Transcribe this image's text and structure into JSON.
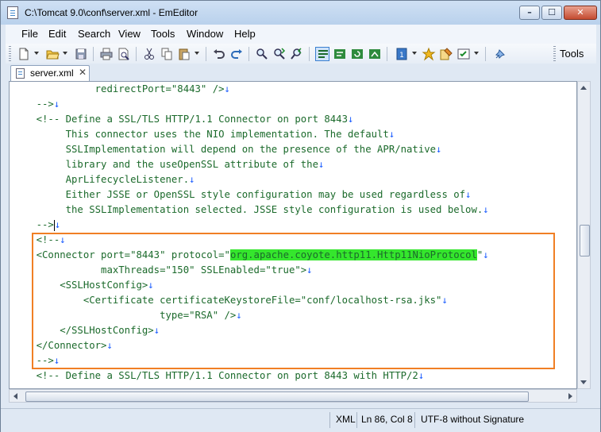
{
  "window": {
    "title": "C:\\Tomcat 9.0\\conf\\server.xml - EmEditor",
    "controls": {
      "minimize": "–",
      "maximize": "☐",
      "close": "✕"
    }
  },
  "menu": {
    "items": [
      "File",
      "Edit",
      "Search",
      "View",
      "Tools",
      "Window",
      "Help"
    ]
  },
  "toolbar": {
    "tools_label": "Tools",
    "icons": [
      "new-file-icon",
      "open-folder-icon",
      "save-icon",
      "print-icon",
      "print-preview-icon",
      "cut-icon",
      "copy-icon",
      "paste-icon",
      "undo-icon",
      "redo-icon",
      "find-icon",
      "find-next-icon",
      "find-prev-icon",
      "word-wrap-icon",
      "view-mode-icon",
      "refresh-icon",
      "toggle-icon",
      "macro-icon",
      "plugin-icon",
      "customize-icon",
      "properties-icon",
      "pin-icon"
    ]
  },
  "tab": {
    "label": "server.xml",
    "close": "✕"
  },
  "editor": {
    "lines": [
      {
        "indent": "              ",
        "text": "redirectPort=\"8443\" />"
      },
      {
        "indent": "    ",
        "text": "-->"
      },
      {
        "indent": "    ",
        "text": "<!-- Define a SSL/TLS HTTP/1.1 Connector on port 8443"
      },
      {
        "indent": "         ",
        "text": "This connector uses the NIO implementation. The default"
      },
      {
        "indent": "         ",
        "text": "SSLImplementation will depend on the presence of the APR/native"
      },
      {
        "indent": "         ",
        "text": "library and the useOpenSSL attribute of the"
      },
      {
        "indent": "         ",
        "text": "AprLifecycleListener."
      },
      {
        "indent": "         ",
        "text": "Either JSSE or OpenSSL style configuration may be used regardless of"
      },
      {
        "indent": "         ",
        "text": "the SSLImplementation selected. JSSE style configuration is used below."
      },
      {
        "indent": "    ",
        "text": "-->"
      },
      {
        "indent": "    ",
        "text": "<!--"
      },
      {
        "indent": "    ",
        "text": "<Connector port=\"8443\" protocol=\"",
        "highlight": "org.apache.coyote.http11.Http11NioProtocol",
        "after": "\""
      },
      {
        "indent": "               ",
        "text": "maxThreads=\"150\" SSLEnabled=\"true\">"
      },
      {
        "indent": "        ",
        "text": "<SSLHostConfig>"
      },
      {
        "indent": "            ",
        "text": "<Certificate certificateKeystoreFile=\"conf/localhost-rsa.jks\""
      },
      {
        "indent": "                         ",
        "text": "type=\"RSA\" />"
      },
      {
        "indent": "        ",
        "text": "</SSLHostConfig>"
      },
      {
        "indent": "    ",
        "text": "</Connector>"
      },
      {
        "indent": "    ",
        "text": "-->"
      },
      {
        "indent": "    ",
        "text": "<!-- Define a SSL/TLS HTTP/1.1 Connector on port 8443 with HTTP/2"
      }
    ],
    "eol_marker": "↓"
  },
  "status": {
    "mode": "XML",
    "position": "Ln 86, Col 8",
    "encoding": "UTF-8 without Signature"
  },
  "colors": {
    "code_text": "#1b6a2b",
    "eol_marker": "#2060ff",
    "highlight": "#35e62d",
    "annotation_box": "#f07f24"
  }
}
